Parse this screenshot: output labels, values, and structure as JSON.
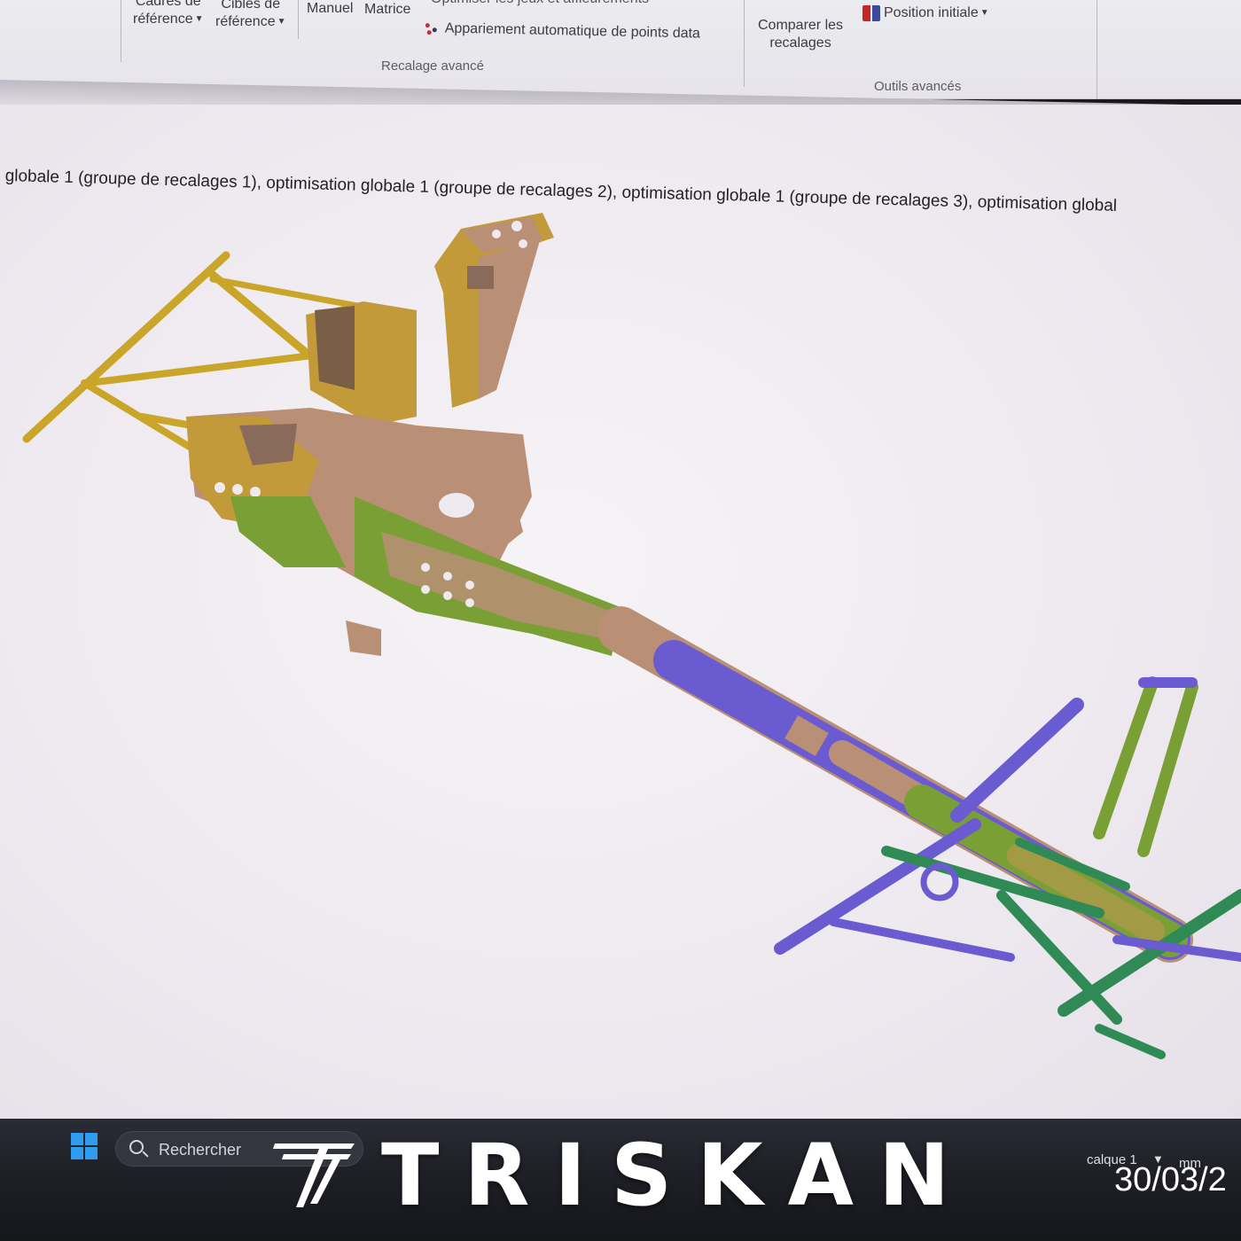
{
  "ribbon": {
    "cadres_line1": "Cadres de",
    "cadres_line2": "référence",
    "cibles_line1": "Cibles de",
    "cibles_line2": "référence",
    "manuel": "Manuel",
    "matrice": "Matrice",
    "optimiser": "Optimiser les jeux et affleurements",
    "appariement": "Appariement automatique de points data",
    "group_recalage": "Recalage avancé",
    "comparer_line1": "Comparer les",
    "comparer_line2": "recalages",
    "position": "Position initiale",
    "group_outils": "Outils avancés"
  },
  "workspace": {
    "status_text": "globale 1 (groupe de recalages 1), optimisation globale 1 (groupe de recalages 2), optimisation globale 1 (groupe de recalages 3), optimisation global"
  },
  "taskbar": {
    "search_placeholder": "Rechercher",
    "layer": "calque 1",
    "unit": "mm",
    "date": "30/03/2"
  },
  "watermark": {
    "brand": "TRISKAN"
  },
  "colors": {
    "frame_yellow": "#c9a52a",
    "frame_tan": "#b98f75",
    "deviation_green": "#7aa035",
    "deviation_purple": "#6a5bd0",
    "frame_teal": "#2f8a55",
    "windows_blue": "#2f9cf0"
  },
  "icons": [
    "windows-start-icon",
    "search-icon",
    "auto-match-icon",
    "initial-position-icon",
    "triskan-logo-mark"
  ]
}
